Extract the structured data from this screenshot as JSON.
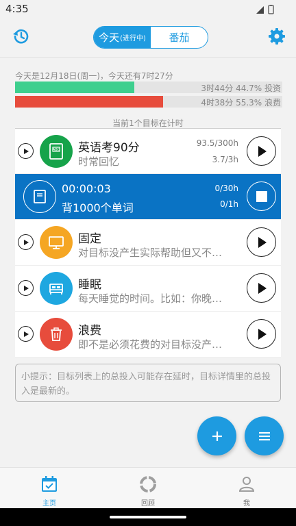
{
  "status_bar": {
    "time": "4:35"
  },
  "header": {
    "tabs": [
      {
        "label": "今天",
        "sub": "(进行中)"
      },
      {
        "label": "番茄"
      }
    ]
  },
  "summary": {
    "text": "今天是12月18日(周一)，今天还有7时27分",
    "invest": {
      "label": "3时44分 44.7% 投资",
      "percent": 44.7,
      "color": "#3ecf8e"
    },
    "waste": {
      "label": "4时38分 55.3% 浪费",
      "percent": 55.3,
      "color": "#e74c3c"
    }
  },
  "timing_note": "当前1个目标在计时",
  "goals": [
    {
      "title": "英语考90分",
      "subtitle": "时常回忆",
      "stat1": "93.5/300h",
      "stat2": "3.7/3h",
      "icon": "book-icon",
      "color": "#16a34a"
    },
    {
      "title": "固定",
      "subtitle": "对目标没产生实际帮助但又不…",
      "icon": "monitor-icon",
      "color": "#f5a623"
    },
    {
      "title": "睡眠",
      "subtitle": "每天睡觉的时间。比如：你晚…",
      "icon": "bed-icon",
      "color": "#1ea7e0"
    },
    {
      "title": "浪费",
      "subtitle": "即不是必须花费的对目标没产…",
      "icon": "trash-icon",
      "color": "#e74c3c"
    }
  ],
  "active_goal": {
    "timer": "00:00:03",
    "title": "背1000个单词",
    "stat1": "0/30h",
    "stat2": "0/1h",
    "icon": "notebook-icon",
    "color": "#0a73c4"
  },
  "tip": "小提示：目标列表上的总投入可能存在延时，目标详情里的总投入是最新的。",
  "fabs": [
    {
      "icon": "plus-icon"
    },
    {
      "icon": "menu-icon"
    }
  ],
  "bottom_nav": [
    {
      "label": "主页",
      "icon": "calendar-check-icon",
      "active": true
    },
    {
      "label": "回顾",
      "icon": "ring-icon",
      "active": false
    },
    {
      "label": "我",
      "icon": "person-icon",
      "active": false
    }
  ],
  "colors": {
    "accent": "#1e9be0",
    "active_row": "#0a73c4"
  }
}
